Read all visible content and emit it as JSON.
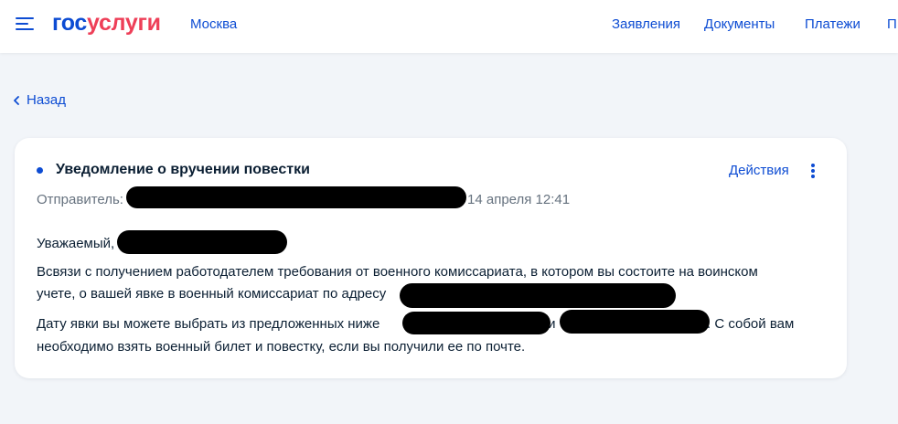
{
  "header": {
    "logo_part1": "гос",
    "logo_part2": "услуги",
    "city": "Москва",
    "nav": [
      "Заявления",
      "Документы",
      "Платежи",
      "П"
    ]
  },
  "back_label": "Назад",
  "notice": {
    "title": "Уведомление о вручении повестки",
    "actions_label": "Действия",
    "sender_label": "Отправитель:",
    "date": "14 апреля 12:41",
    "greeting": "Уважаемый,",
    "paragraph1_line1": "Всвязи с получением работодателем требования от военного комиссариата, в котором вы состоите на воинском",
    "paragraph1_line2": "учете, о вашей явке в военный комиссариат по адресу",
    "paragraph2_line1_a": "Дату явки вы можете выбрать из предложенных ниже",
    "paragraph2_line1_b": "или",
    "paragraph2_line1_c": ". С собой вам",
    "paragraph2_line2": "необходимо взять военный билет и повестку, если вы получили ее по почте."
  },
  "colors": {
    "brand_blue": "#0d4cd3",
    "brand_red": "#ee3f58",
    "page_bg": "#f2f5f9",
    "text": "#0b1f33",
    "muted": "#66727f"
  },
  "icons": [
    "menu-icon",
    "chevron-left-icon",
    "kebab-menu-icon"
  ]
}
